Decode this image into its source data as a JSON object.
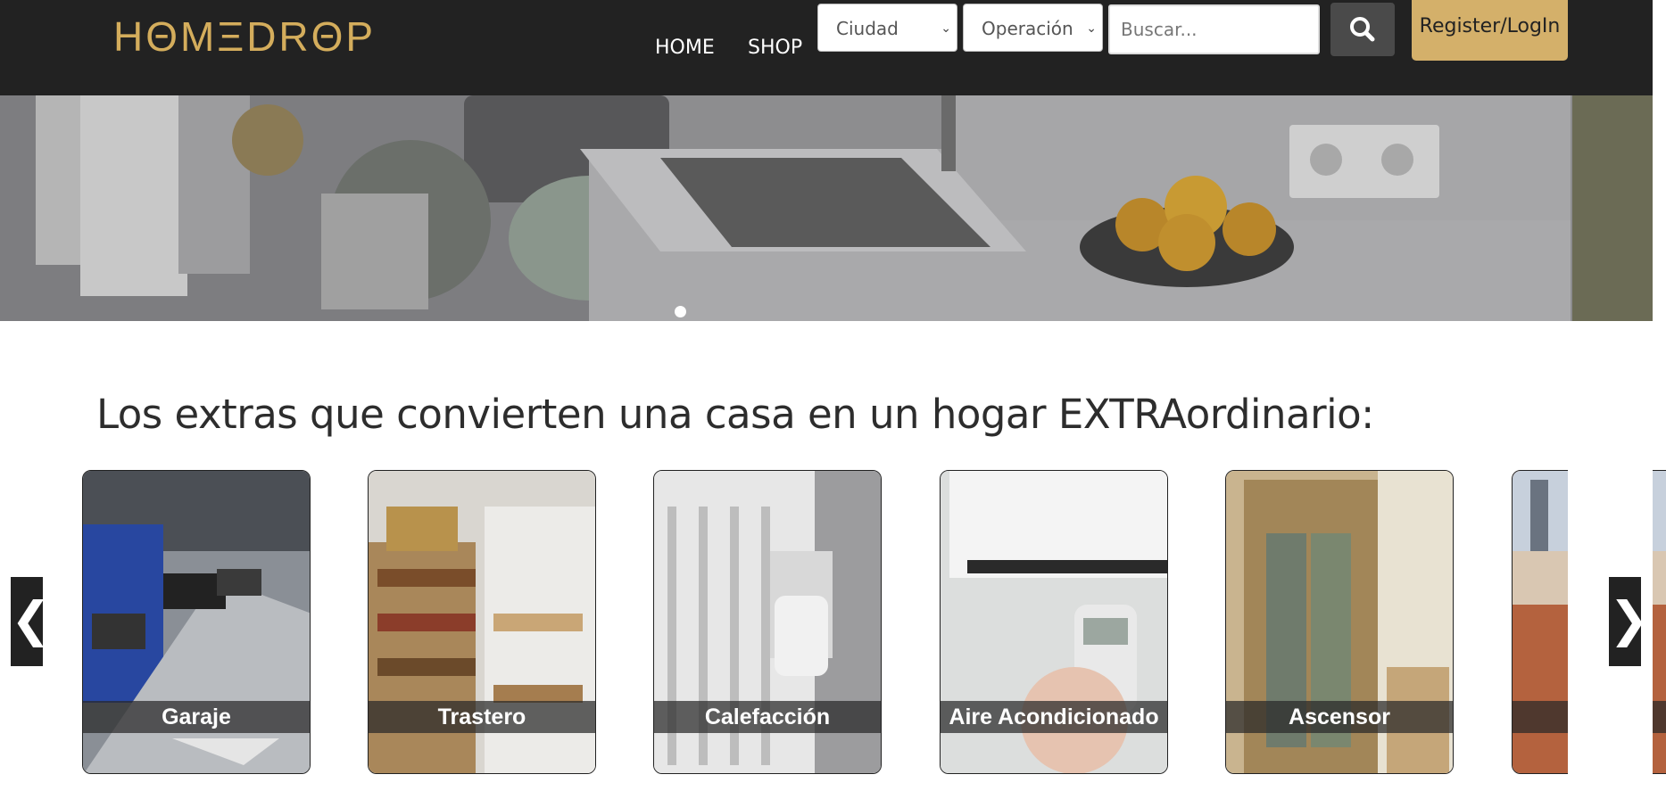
{
  "header": {
    "logo": "HΘMΞDRΘP",
    "nav": [
      "HOME",
      "SHOP"
    ],
    "city_select": "Ciudad",
    "operation_select": "Operación",
    "search_placeholder": "Buscar...",
    "register_label": "Register/LogIn"
  },
  "section": {
    "title": "Los extras que convierten una casa en un hogar EXTRAordinario:"
  },
  "extras": [
    {
      "label": "Garaje"
    },
    {
      "label": "Trastero"
    },
    {
      "label": "Calefacción"
    },
    {
      "label": "Aire Acondicionado"
    },
    {
      "label": "Ascensor"
    }
  ],
  "carousel": {
    "prev_glyph": "❮",
    "next_glyph": "❯",
    "active_slide": 1,
    "slide_count": 1
  },
  "colors": {
    "header_bg": "#222222",
    "brand_gold": "#d4ad5c",
    "register_bg": "#d4b06a"
  }
}
